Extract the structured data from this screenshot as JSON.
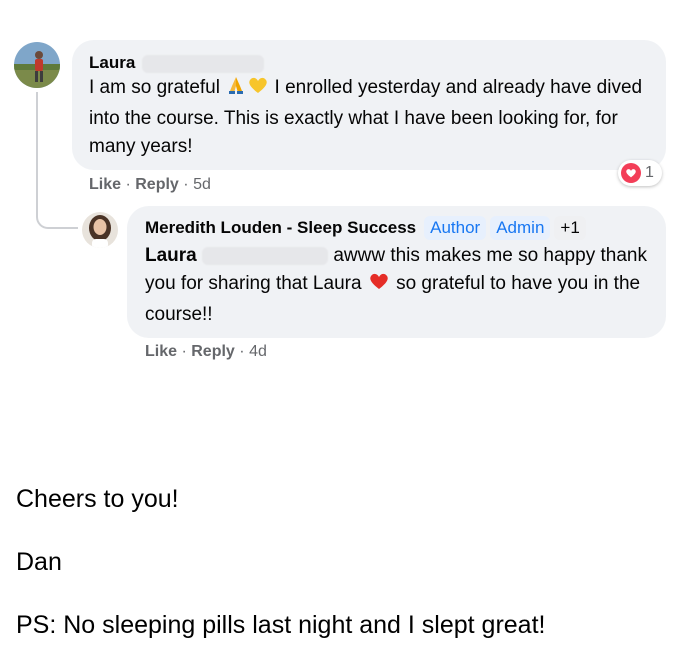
{
  "comment1": {
    "author": "Laura",
    "text_before_emoji": "I am so grateful ",
    "text_after_emoji": " I enrolled yesterday and already have dived into the course. This is exactly what I have been looking for, for many years!",
    "emojis": [
      "folded-hands",
      "yellow-heart"
    ],
    "like_label": "Like",
    "reply_label": "Reply",
    "time": "5d",
    "reaction_count": "1",
    "reaction_color": "#f33e58"
  },
  "comment2": {
    "author": "Meredith Louden - Sleep Success",
    "badges": [
      "Author",
      "Admin",
      "+1"
    ],
    "mention": "Laura",
    "text_part1": "awww this makes me so happy thank you for sharing that Laura",
    "text_part2": " so grateful to have you in the course!!",
    "emoji": "red-heart",
    "like_label": "Like",
    "reply_label": "Reply",
    "time": "4d"
  },
  "letter": {
    "line1": "Cheers to you!",
    "line2": "Dan",
    "line3": "PS:  No sleeping pills last night and I slept great!"
  },
  "colors": {
    "bubble_bg": "#f0f2f5",
    "badge_bg": "#e7f0fd",
    "badge_text": "#1877f2",
    "meta_text": "#65676b"
  }
}
